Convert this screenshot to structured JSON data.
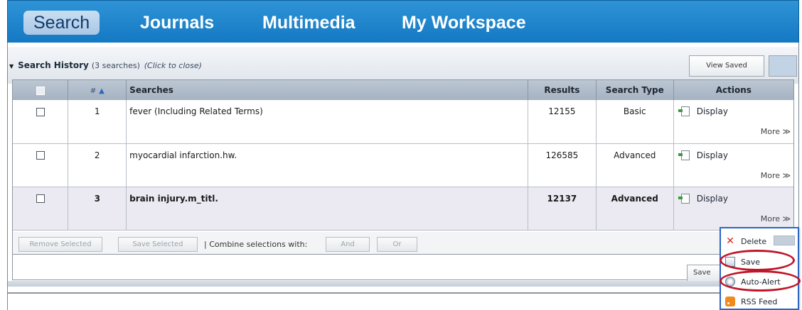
{
  "nav": {
    "tabs": [
      {
        "label": "Search",
        "active": true
      },
      {
        "label": "Journals",
        "active": false
      },
      {
        "label": "Multimedia",
        "active": false
      },
      {
        "label": "My Workspace",
        "active": false
      }
    ]
  },
  "history": {
    "title": "Search History",
    "count_text": "(3 searches)",
    "close_text": "(Click to close)",
    "view_saved_label": "View Saved"
  },
  "table": {
    "headers": {
      "number": "#",
      "sort_indicator": "▲",
      "searches": "Searches",
      "results": "Results",
      "search_type": "Search Type",
      "actions": "Actions"
    },
    "rows": [
      {
        "number": "1",
        "search": "fever (Including Related Terms)",
        "results": "12155",
        "type": "Basic",
        "display": "Display",
        "more": "More ≫"
      },
      {
        "number": "2",
        "search": "myocardial infarction.hw.",
        "results": "126585",
        "type": "Advanced",
        "display": "Display",
        "more": "More ≫"
      },
      {
        "number": "3",
        "search": "brain injury.m_titl.",
        "results": "12137",
        "type": "Advanced",
        "display": "Display",
        "more": "More ≫"
      }
    ]
  },
  "actions_bar": {
    "remove_selected": "Remove Selected",
    "save_selected": "Save Selected",
    "combine_label": "| Combine selections with:",
    "and_label": "And",
    "or_label": "Or",
    "save_button": "Save"
  },
  "more_menu": {
    "items": [
      {
        "label": "Delete",
        "icon": "delete-icon"
      },
      {
        "label": "Save",
        "icon": "save-icon"
      },
      {
        "label": "Auto-Alert",
        "icon": "auto-alert-icon"
      },
      {
        "label": "RSS Feed",
        "icon": "rss-feed-icon"
      }
    ]
  },
  "colors": {
    "nav_blue": "#1479c3",
    "highlight_red": "#c0172a",
    "menu_border": "#2d66c2"
  }
}
